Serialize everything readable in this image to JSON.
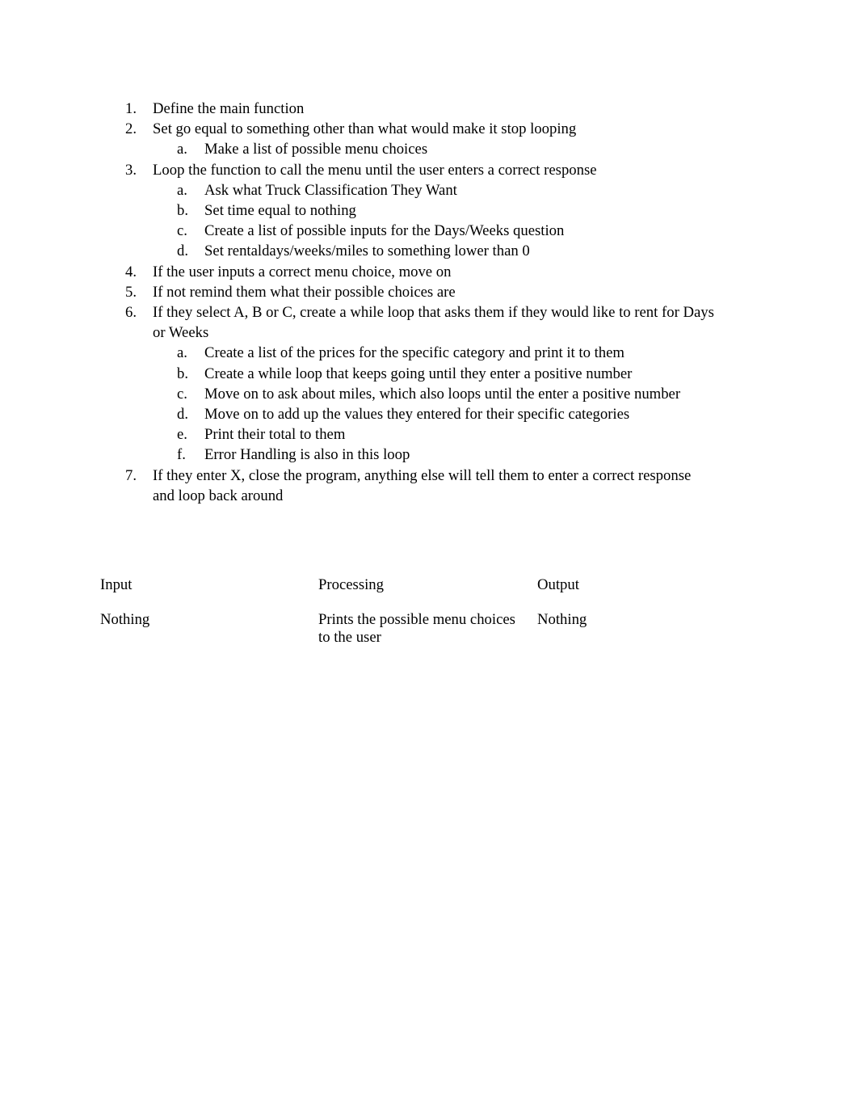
{
  "document": {
    "type": "pseudocode-outline",
    "background_color": "#ffffff",
    "text_color": "#000000"
  },
  "outline": {
    "items": [
      {
        "marker": "1.",
        "level": 1,
        "text": "Define the main function"
      },
      {
        "marker": "2.",
        "level": 1,
        "text": "Set go equal to something other than what would make it stop looping"
      },
      {
        "marker": "a.",
        "level": 2,
        "text": "Make a list of possible menu choices"
      },
      {
        "marker": "3.",
        "level": 1,
        "text": "Loop the function to call the menu until the user enters a correct response"
      },
      {
        "marker": "a.",
        "level": 2,
        "text": "Ask what Truck Classification They Want"
      },
      {
        "marker": "b.",
        "level": 2,
        "text": "Set time equal to nothing"
      },
      {
        "marker": "c.",
        "level": 2,
        "text": "Create a list of possible inputs for the Days/Weeks question"
      },
      {
        "marker": "d.",
        "level": 2,
        "text": "Set rentaldays/weeks/miles to something lower than 0"
      },
      {
        "marker": "4.",
        "level": 1,
        "text": "If the user inputs a correct menu choice, move on"
      },
      {
        "marker": "5.",
        "level": 1,
        "text": "If not remind them what their possible choices are"
      },
      {
        "marker": "6.",
        "level": 1,
        "text": "If they select A, B or C, create a while loop that asks them if they would like to rent for Days or Weeks"
      },
      {
        "marker": "a.",
        "level": 2,
        "text": "Create a list of the prices for the specific category and print it to them"
      },
      {
        "marker": "b.",
        "level": 2,
        "text": "Create a while loop that keeps going until they enter a positive number"
      },
      {
        "marker": "c.",
        "level": 2,
        "text": "Move on to ask about miles, which also loops until the enter a positive number"
      },
      {
        "marker": "d.",
        "level": 2,
        "text": "Move on to add up the values they entered for their specific categories"
      },
      {
        "marker": "e.",
        "level": 2,
        "text": "Print their total to them"
      },
      {
        "marker": "f.",
        "level": 2,
        "text": "Error Handling is also in this loop"
      },
      {
        "marker": "7.",
        "level": 1,
        "text": "If they enter X, close the program, anything else will tell them to enter a correct response and loop back around"
      }
    ]
  },
  "io_table": {
    "headers": {
      "input": "Input",
      "processing": "Processing",
      "output": "Output"
    },
    "rows": [
      {
        "input": "Nothing",
        "processing": "Prints the possible menu choices to the user",
        "output": "Nothing"
      }
    ]
  }
}
